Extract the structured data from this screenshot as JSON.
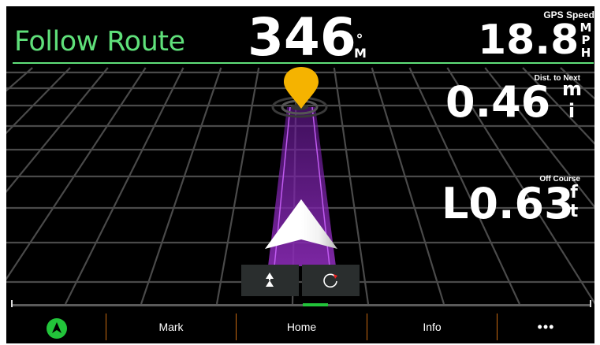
{
  "header": {
    "mode_title": "Follow Route",
    "heading_value": "346",
    "heading_unit_top": "°",
    "heading_unit_bottom": "M",
    "gps_speed_label": "GPS Speed",
    "gps_speed_value": "18.8",
    "gps_speed_unit": [
      "M",
      "P",
      "H"
    ]
  },
  "data_fields": {
    "dist_label": "Dist. to Next",
    "dist_value": "0.46",
    "dist_unit": [
      "m",
      "i"
    ],
    "off_course_label": "Off Course",
    "off_course_value": "L0.63",
    "off_course_unit": [
      "f",
      "t"
    ]
  },
  "controls": {
    "course_up_icon": "course-up-icon",
    "reset_icon": "refresh-icon"
  },
  "bottom_bar": {
    "nav_icon": "navigation-arrow-icon",
    "items": [
      "Mark",
      "Home",
      "Info",
      "•••"
    ]
  },
  "colors": {
    "accent": "#5fe07a",
    "route": "#8a2bb5",
    "waypoint": "#f5b300",
    "separator": "#c86a10",
    "active_green": "#22c43a"
  }
}
